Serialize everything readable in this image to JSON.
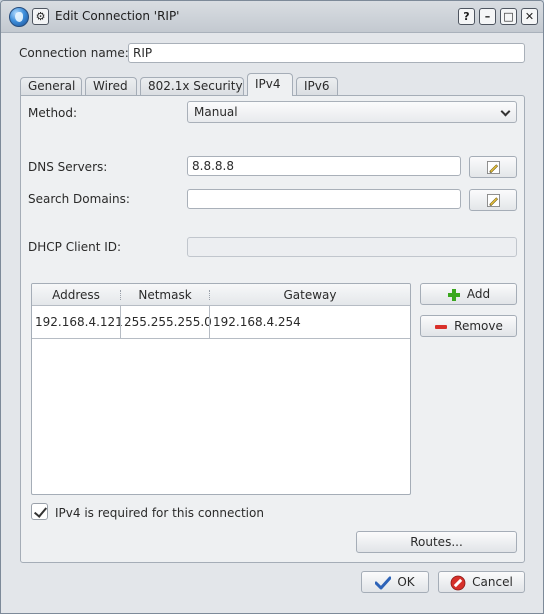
{
  "window": {
    "title": "Edit Connection 'RIP'",
    "buttons": {
      "help": "?",
      "minimize": "–",
      "maximize": "□",
      "close": "✕"
    },
    "menu_glyph": "⚙"
  },
  "connection_name": {
    "label": "Connection name:",
    "value": "RIP"
  },
  "tabs": [
    {
      "label": "General"
    },
    {
      "label": "Wired"
    },
    {
      "label": "802.1x Security"
    },
    {
      "label": "IPv4",
      "active": true
    },
    {
      "label": "IPv6"
    }
  ],
  "ipv4": {
    "method_label": "Method:",
    "method_value": "Manual",
    "dns_label": "DNS Servers:",
    "dns_value": "8.8.8.8",
    "search_label": "Search Domains:",
    "search_value": "",
    "dhcp_label": "DHCP Client ID:",
    "dhcp_value": "",
    "table": {
      "columns": [
        "Address",
        "Netmask",
        "Gateway"
      ],
      "rows": [
        [
          "192.168.4.121",
          "255.255.255.0",
          "192.168.4.254"
        ]
      ]
    },
    "add_label": "Add",
    "remove_label": "Remove",
    "required_checked": true,
    "required_label": "IPv4 is required for this connection",
    "routes_label": "Routes..."
  },
  "dialog": {
    "ok_label": "OK",
    "cancel_label": "Cancel"
  },
  "colors": {
    "add_icon": "#3aa71e",
    "remove_icon": "#d9302a",
    "cancel_icon": "#d6312b",
    "ok_icon": "#2d63b8"
  }
}
